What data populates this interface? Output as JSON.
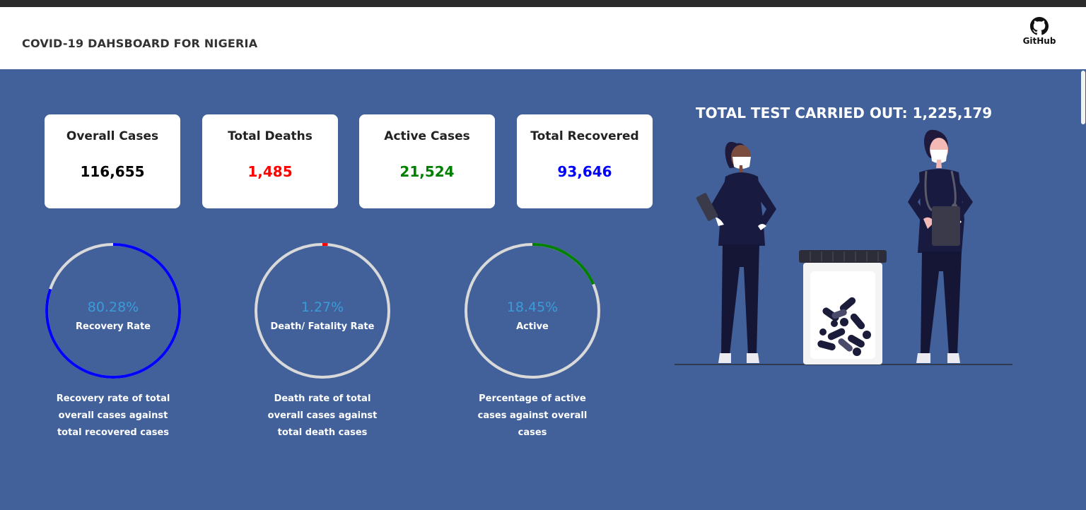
{
  "header": {
    "title": "COVID-19 DAHSBOARD FOR NIGERIA",
    "github_label": "GitHub",
    "github_icon": "github-icon"
  },
  "cards": [
    {
      "label": "Overall Cases",
      "value": "116,655",
      "color": "#000000"
    },
    {
      "label": "Total Deaths",
      "value": "1,485",
      "color": "#ff0000"
    },
    {
      "label": "Active Cases",
      "value": "21,524",
      "color": "#008000"
    },
    {
      "label": "Total Recovered",
      "value": "93,646",
      "color": "#0000ff"
    }
  ],
  "gauges": [
    {
      "percent_label": "80.28%",
      "name": "Recovery Rate",
      "fraction": 0.8028,
      "color": "#0000ff",
      "desc": [
        "Recovery rate of total",
        "overall cases against",
        "total recovered cases"
      ]
    },
    {
      "percent_label": "1.27%",
      "name": "Death/ Fatality Rate",
      "fraction": 0.0127,
      "color": "#ff0000",
      "desc": [
        "Death rate of total",
        "overall cases against",
        "total death cases"
      ]
    },
    {
      "percent_label": "18.45%",
      "name": "Active",
      "fraction": 0.1845,
      "color": "#008000",
      "desc": [
        "Percentage of active",
        "cases against overall",
        "cases"
      ]
    }
  ],
  "tests": {
    "text": "TOTAL TEST CARRIED OUT: 1,225,179"
  },
  "colors": {
    "background": "#42619a",
    "gauge_track": "#d9d9d9",
    "percent_text": "#3b9bd8"
  }
}
